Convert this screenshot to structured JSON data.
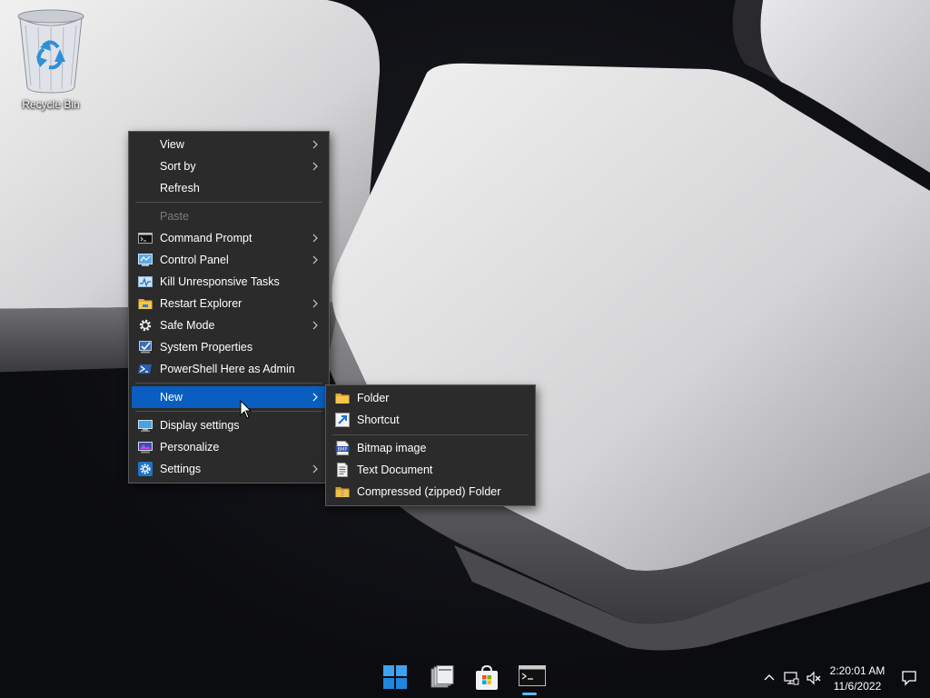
{
  "desktop": {
    "icons": [
      {
        "label": "Recycle Bin",
        "icon": "recycle-bin-icon"
      }
    ]
  },
  "context_menu": {
    "items": [
      {
        "label": "View",
        "icon": null,
        "submenu": true
      },
      {
        "label": "Sort by",
        "icon": null,
        "submenu": true
      },
      {
        "label": "Refresh",
        "icon": null,
        "submenu": false
      },
      {
        "label": "Paste",
        "icon": null,
        "submenu": false,
        "disabled": true
      },
      {
        "label": "Command Prompt",
        "icon": "command-prompt-icon",
        "submenu": true
      },
      {
        "label": "Control Panel",
        "icon": "control-panel-icon",
        "submenu": true
      },
      {
        "label": "Kill Unresponsive Tasks",
        "icon": "task-manager-icon",
        "submenu": false
      },
      {
        "label": "Restart Explorer",
        "icon": "folder-icon",
        "submenu": true
      },
      {
        "label": "Safe Mode",
        "icon": "gear-icon",
        "submenu": true
      },
      {
        "label": "System Properties",
        "icon": "system-properties-icon",
        "submenu": false
      },
      {
        "label": "PowerShell Here as Admin",
        "icon": "powershell-icon",
        "submenu": false
      },
      {
        "label": "New",
        "icon": null,
        "submenu": true,
        "highlighted": true
      },
      {
        "label": "Display settings",
        "icon": "display-icon",
        "submenu": false
      },
      {
        "label": "Personalize",
        "icon": "personalize-icon",
        "submenu": false
      },
      {
        "label": "Settings",
        "icon": "settings-icon",
        "submenu": true
      }
    ]
  },
  "new_submenu": {
    "items": [
      {
        "label": "Folder",
        "icon": "folder-icon"
      },
      {
        "label": "Shortcut",
        "icon": "shortcut-icon"
      },
      {
        "label": "Bitmap image",
        "icon": "bitmap-icon"
      },
      {
        "label": "Text Document",
        "icon": "text-document-icon"
      },
      {
        "label": "Compressed (zipped) Folder",
        "icon": "zip-folder-icon"
      }
    ]
  },
  "taskbar": {
    "apps": [
      {
        "name": "start-button",
        "icon": "windows-logo-icon"
      },
      {
        "name": "file-explorer",
        "icon": "file-explorer-icon"
      },
      {
        "name": "microsoft-store",
        "icon": "store-icon"
      },
      {
        "name": "command-prompt",
        "icon": "terminal-icon",
        "active": true
      }
    ],
    "tray": {
      "icons": [
        "chevron-up-icon",
        "network-icon",
        "volume-muted-icon"
      ],
      "time": "2:20:01 AM",
      "date": "11/6/2022",
      "notification_icon": "notification-icon"
    }
  },
  "colors": {
    "menu_bg": "#2b2b2b",
    "highlight": "#0a5ec0",
    "taskbar_indicator": "#60b8ff"
  }
}
